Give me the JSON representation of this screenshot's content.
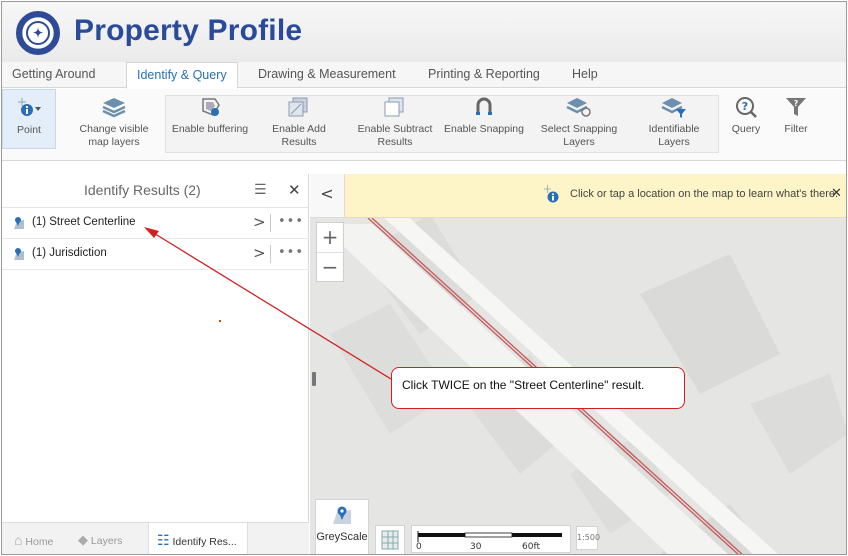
{
  "header": {
    "title": "Property Profile",
    "logo_icon": "city-seal-icon"
  },
  "tabs": [
    {
      "label": "Getting Around",
      "active": false
    },
    {
      "label": "Identify & Query",
      "active": true
    },
    {
      "label": "Drawing & Measurement",
      "active": false
    },
    {
      "label": "Printing & Reporting",
      "active": false
    },
    {
      "label": "Help",
      "active": false
    }
  ],
  "toolbar": {
    "point": "Point",
    "change_layers_1": "Change visible",
    "change_layers_2": "map layers",
    "buffering": "Enable buffering",
    "add_1": "Enable Add",
    "add_2": "Results",
    "subtract_1": "Enable Subtract",
    "subtract_2": "Results",
    "snapping": "Enable Snapping",
    "select_snap_1": "Select Snapping",
    "select_snap_2": "Layers",
    "identifiable_1": "Identifiable",
    "identifiable_2": "Layers",
    "query": "Query",
    "filter": "Filter"
  },
  "panel": {
    "title": "Identify Results (2)",
    "results": [
      {
        "label": "(1) Street Centerline"
      },
      {
        "label": "(1) Jurisdiction"
      }
    ]
  },
  "bottom_tabs": {
    "home": "Home",
    "layers": "Layers",
    "identify": "Identify Res..."
  },
  "map": {
    "info": "Click or tap a location on the map to learn what's there.",
    "close": "✕",
    "basemap": "GreyScale",
    "scale_0": "0",
    "scale_30": "30",
    "scale_60": "60ft",
    "scale_btn": "1:500"
  },
  "callout": {
    "text": "Click TWICE on the \"Street Centerline\" result."
  },
  "colors": {
    "accent": "#2a6fb6",
    "title": "#2a4a9a",
    "callout_border": "#d02020",
    "info_bar": "#fdf5c7"
  }
}
